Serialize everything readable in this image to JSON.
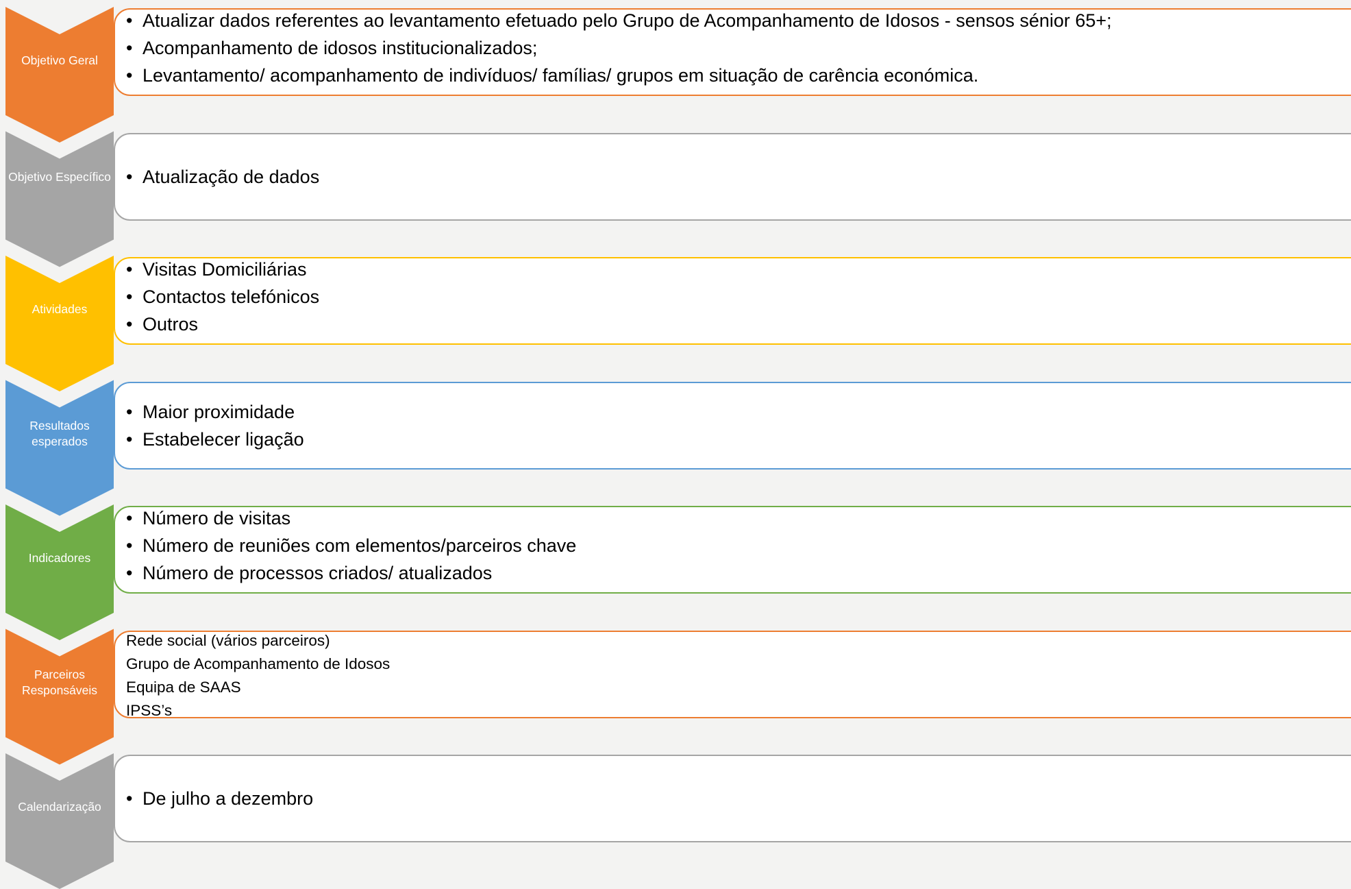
{
  "colors": {
    "background": "#f3f3f2",
    "orange": "#ed7d31",
    "gray": "#a5a5a5",
    "yellow": "#ffc000",
    "blue": "#5b9bd5",
    "green": "#70ad47"
  },
  "rows": [
    {
      "label": "Objetivo Geral",
      "color": "orange",
      "style": "bullets",
      "items": [
        "Atualizar dados referentes ao levantamento efetuado pelo Grupo de Acompanhamento de Idosos  - sensos sénior 65+;",
        "Acompanhamento de idosos institucionalizados;",
        "Levantamento/ acompanhamento de indivíduos/ famílias/ grupos em situação de carência económica."
      ]
    },
    {
      "label": "Objetivo Específico",
      "color": "gray",
      "style": "bullets",
      "items": [
        "Atualização de dados"
      ]
    },
    {
      "label": "Atividades",
      "color": "yellow",
      "style": "bullets",
      "items": [
        "Visitas Domiciliárias",
        "Contactos telefónicos",
        "Outros"
      ]
    },
    {
      "label": "Resultados esperados",
      "color": "blue",
      "style": "bullets",
      "items": [
        "Maior proximidade",
        "Estabelecer ligação"
      ]
    },
    {
      "label": "Indicadores",
      "color": "green",
      "style": "bullets",
      "items": [
        "Número de visitas",
        "Número de reuniões com elementos/parceiros chave",
        "Número de processos criados/ atualizados"
      ]
    },
    {
      "label": "Parceiros Responsáveis",
      "color": "orange",
      "style": "plain",
      "items": [
        "Rede social (vários parceiros)",
        "Grupo de Acompanhamento de Idosos",
        "Equipa de SAAS",
        "IPSS’s"
      ]
    },
    {
      "label": "Calendarização",
      "color": "gray",
      "style": "bullets",
      "items": [
        "De julho a dezembro"
      ]
    }
  ]
}
